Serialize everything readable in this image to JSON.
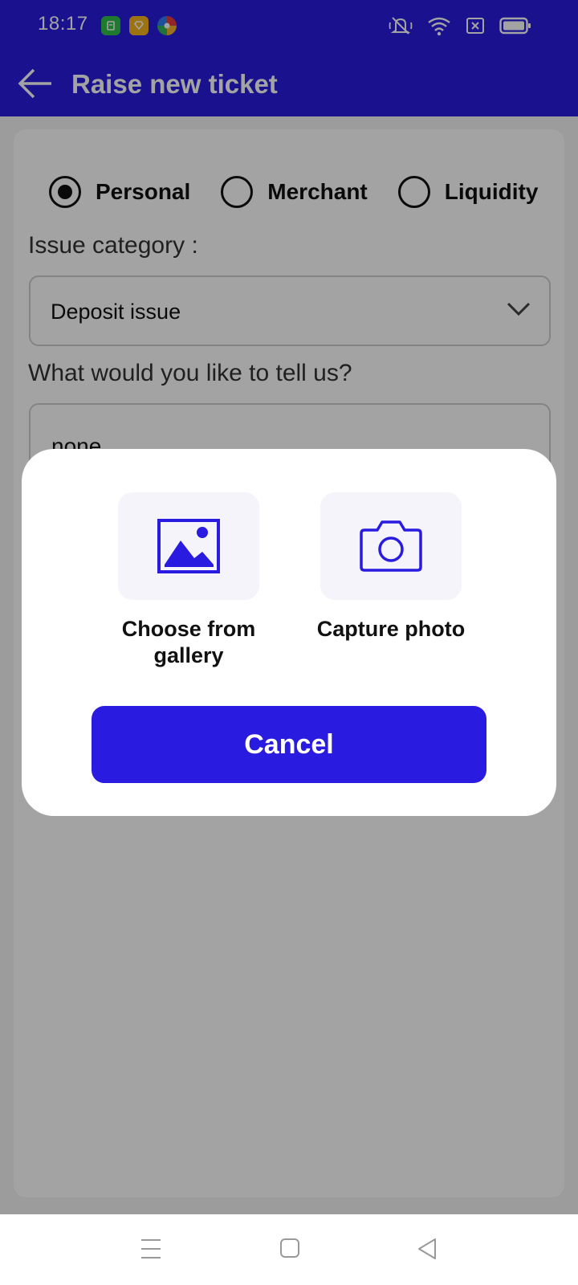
{
  "status_bar": {
    "time": "18:17",
    "app_icons": [
      "green-app-icon",
      "yellow-app-icon",
      "browser-app-icon"
    ],
    "system_icons": [
      "mute-icon",
      "wifi-icon",
      "sim-icon",
      "battery-icon"
    ]
  },
  "app_bar": {
    "title": "Raise new ticket",
    "back_icon": "arrow-left-icon"
  },
  "form": {
    "account_types": [
      {
        "label": "Personal",
        "selected": true
      },
      {
        "label": "Merchant",
        "selected": false
      },
      {
        "label": "Liquidity",
        "selected": false
      }
    ],
    "issue_category_label": "Issue category :",
    "issue_category_value": "Deposit issue",
    "message_label": "What would you like to tell us?",
    "message_value": "none"
  },
  "dialog": {
    "gallery_label": "Choose from gallery",
    "camera_label": "Capture photo",
    "cancel_label": "Cancel"
  },
  "colors": {
    "brand": "#2a1be0",
    "tile_bg": "#f5f4fb",
    "scrim": "rgba(0,0,0,0.36)"
  },
  "nav_bar": {
    "buttons": [
      "menu-icon",
      "home-icon",
      "back-triangle-icon"
    ]
  }
}
